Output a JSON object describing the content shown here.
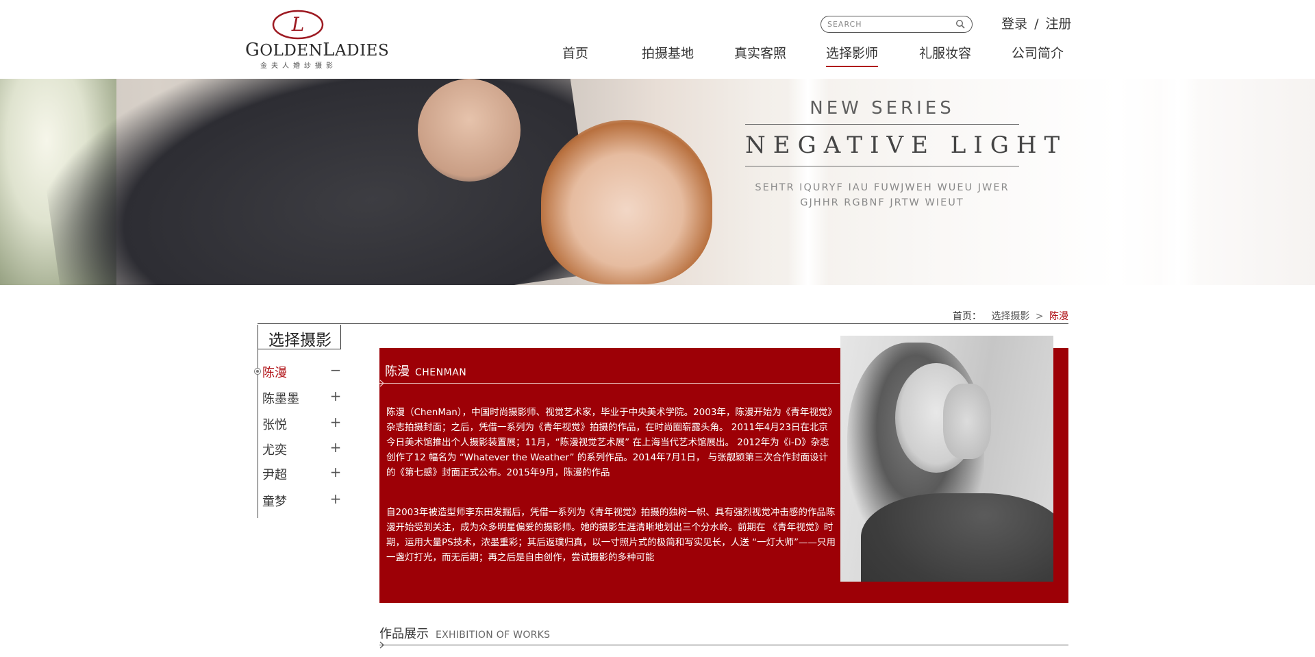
{
  "brand": {
    "logo_letter": "L",
    "logo_word_first": "G",
    "logo_word_mid": "OLDEN",
    "logo_word_second": "L",
    "logo_word_end": "ADIES",
    "logo_sub": "金夫人婚纱摄影",
    "accent_color": "#b01015",
    "panel_color": "#9d0006"
  },
  "search": {
    "placeholder": "SEARCH",
    "value": "",
    "icon": "search-icon"
  },
  "auth": {
    "login": "登录",
    "separator": "/",
    "register": "注册"
  },
  "nav": {
    "items": [
      {
        "label": "首页",
        "active": false
      },
      {
        "label": "拍摄基地",
        "active": false
      },
      {
        "label": "真实客照",
        "active": false
      },
      {
        "label": "选择影师",
        "active": true
      },
      {
        "label": "礼服妆容",
        "active": false
      },
      {
        "label": "公司简介",
        "active": false
      }
    ]
  },
  "banner": {
    "kicker": "NEW SERIES",
    "title": "NEGATIVE LIGHT",
    "sub_line1": "SEHTR IQURYF IAU FUWJWEH WUEU JWER",
    "sub_line2": "GJHHR RGBNF JRTW WIEUT"
  },
  "breadcrumb": {
    "home": "首页：",
    "section": "选择摄影",
    "separator": ">",
    "current": "陈漫"
  },
  "sidebar": {
    "title": "选择摄影",
    "items": [
      {
        "name": "陈漫",
        "toggle": "−",
        "active": true
      },
      {
        "name": "陈墨墨",
        "toggle": "+",
        "active": false
      },
      {
        "name": "张悦",
        "toggle": "+",
        "active": false
      },
      {
        "name": "尤奕",
        "toggle": "+",
        "active": false
      },
      {
        "name": "尹超",
        "toggle": "+",
        "active": false
      },
      {
        "name": "童梦",
        "toggle": "+",
        "active": false
      }
    ]
  },
  "detail": {
    "name_cn": "陈漫",
    "name_en": "CHENMAN",
    "paragraph1": "陈漫（ChenMan），中国时尚摄影师、视觉艺术家，毕业于中央美术学院。2003年，陈漫开始为《青年视觉》杂志拍摄封面；之后，凭借一系列为《青年视觉》拍摄的作品，在时尚圈崭露头角。 2011年4月23日在北京今日美术馆推出个人摄影装置展；11月，“陈漫视觉艺术展” 在上海当代艺术馆展出。 2012年为《i-D》杂志创作了12 幅名为 “Whatever the Weather” 的系列作品。2014年7月1日， 与张靓颖第三次合作封面设计的《第七感》封面正式公布。2015年9月，陈漫的作品",
    "paragraph2": "自2003年被造型师李东田发掘后，凭借一系列为《青年视觉》拍摄的独树一帜、具有强烈视觉冲击感的作品陈漫开始受到关注，成为众多明星偏爱的摄影师。她的摄影生涯清晰地划出三个分水岭。前期在 《青年视觉》时期，运用大量PS技术，浓墨重彩；其后返璞归真，以一寸照片式的极简和写实见长，人送 “一灯大师”——只用一盏灯打光，而无后期；再之后是自由创作，尝试摄影的多种可能"
  },
  "works": {
    "title_cn": "作品展示",
    "title_en": "EXHIBITION OF WORKS"
  }
}
